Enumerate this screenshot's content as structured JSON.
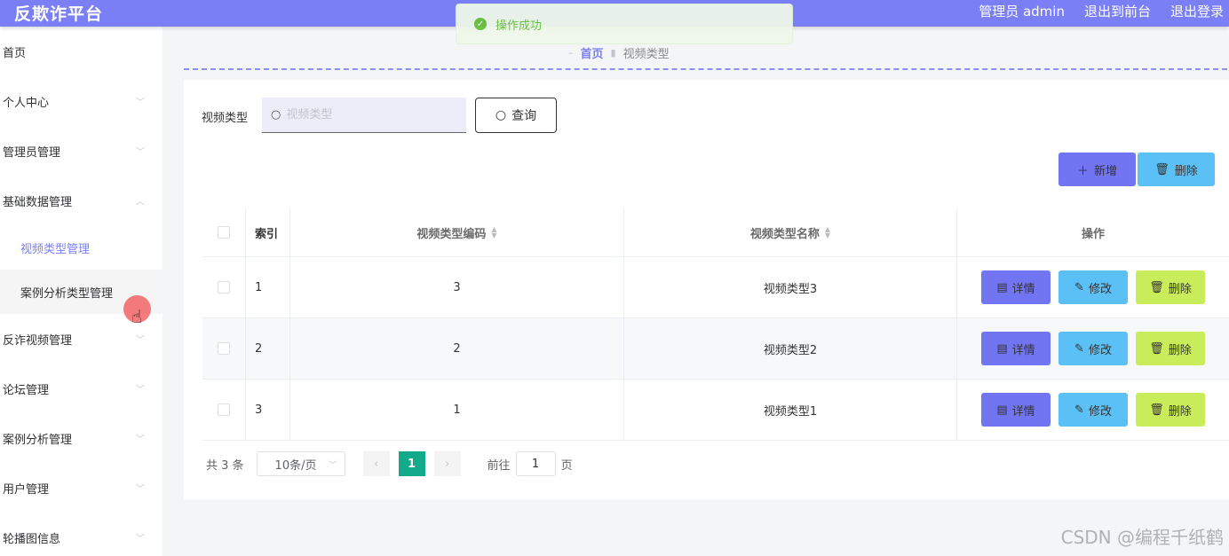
{
  "header": {
    "brand": "反欺诈平台",
    "admin_label": "管理员 admin",
    "front_label": "退出到前台",
    "logout_label": "退出登录"
  },
  "toast": {
    "message": "操作成功"
  },
  "sidebar": {
    "items": [
      {
        "label": "首页"
      },
      {
        "label": "个人中心"
      },
      {
        "label": "管理员管理"
      },
      {
        "label": "基础数据管理"
      },
      {
        "label": "视频类型管理"
      },
      {
        "label": "案例分析类型管理"
      },
      {
        "label": "反诈视频管理"
      },
      {
        "label": "论坛管理"
      },
      {
        "label": "案例分析管理"
      },
      {
        "label": "用户管理"
      },
      {
        "label": "轮播图信息"
      }
    ]
  },
  "breadcrumb": {
    "home": "首页",
    "current": "视频类型"
  },
  "search": {
    "label": "视频类型",
    "placeholder": "视频类型",
    "button": "查询"
  },
  "actions": {
    "add": "新增",
    "delete": "删除"
  },
  "table": {
    "headers": {
      "index": "索引",
      "code": "视频类型编码",
      "name": "视频类型名称",
      "ops": "操作"
    },
    "rows": [
      {
        "index": "1",
        "code": "3",
        "name": "视频类型3"
      },
      {
        "index": "2",
        "code": "2",
        "name": "视频类型2"
      },
      {
        "index": "3",
        "code": "1",
        "name": "视频类型1"
      }
    ],
    "op_labels": {
      "detail": "详情",
      "edit": "修改",
      "delete": "删除"
    }
  },
  "pagination": {
    "total": "共 3 条",
    "page_size": "10条/页",
    "current_page": "1",
    "goto_label": "前往",
    "goto_value": "1",
    "page_suffix": "页"
  },
  "watermark": "CSDN @编程千纸鹤",
  "colors": {
    "header": "#7a7ff5",
    "primary": "#7275f2",
    "info": "#5bc0f6",
    "warning": "#c9ec5b",
    "pager": "#13a98b"
  }
}
